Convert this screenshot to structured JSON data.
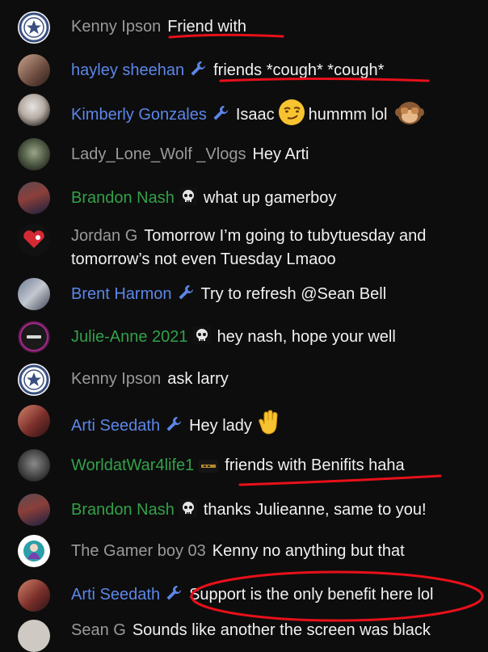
{
  "colors": {
    "background": "#0d0d0d",
    "moderator_name": "#5c86e8",
    "member_name": "#33a04a",
    "viewer_name": "#9a9a9a",
    "annotation": "#e8101a"
  },
  "messages": [
    {
      "author": "Kenny Ipson",
      "role": "viewer",
      "badge": "",
      "avatar": "dallas-star-logo",
      "text": "Friend with"
    },
    {
      "author": "hayley sheehan",
      "role": "moderator",
      "badge": "wrench-icon",
      "avatar": "photo",
      "text": "friends *cough* *cough*"
    },
    {
      "author": "Kimberly Gonzales",
      "role": "moderator",
      "badge": "wrench-icon",
      "avatar": "photo",
      "text_before": "Isaac",
      "emoji1": "smirking-face-emoji",
      "text_after": "hummm lol",
      "emoji2": "see-no-evil-monkey-emoji"
    },
    {
      "author": "Lady_Lone_Wolf _Vlogs",
      "role": "viewer",
      "badge": "",
      "avatar": "photo",
      "text": "Hey Arti"
    },
    {
      "author": "Brandon Nash",
      "role": "member",
      "badge": "skull-icon",
      "avatar": "photo",
      "text": "what up gamerboy"
    },
    {
      "author": "Jordan G",
      "role": "viewer",
      "badge": "",
      "avatar": "photo",
      "text": "Tomorrow I’m going to tubytuesday and tomorrow’s not even Tuesday Lmaoo"
    },
    {
      "author": "Brent Harmon",
      "role": "moderator",
      "badge": "wrench-icon",
      "avatar": "photo",
      "text": "Try to refresh @Sean Bell"
    },
    {
      "author": "Julie-Anne 2021",
      "role": "member",
      "badge": "skull-icon",
      "avatar": "logo",
      "text": "hey nash, hope your well"
    },
    {
      "author": "Kenny Ipson",
      "role": "viewer",
      "badge": "",
      "avatar": "dallas-star-logo",
      "text": "ask larry"
    },
    {
      "author": "Arti Seedath",
      "role": "moderator",
      "badge": "wrench-icon",
      "avatar": "photo",
      "text": "Hey lady",
      "emoji1": "waving-hand-emoji"
    },
    {
      "author": "WorldatWar4life1",
      "role": "member",
      "badge": "member-badge-icon",
      "avatar": "photo",
      "text": "friends with Benifits haha"
    },
    {
      "author": "Brandon Nash",
      "role": "member",
      "badge": "skull-icon",
      "avatar": "photo",
      "text": "thanks Julieanne, same to you!"
    },
    {
      "author": "The Gamer boy 03",
      "role": "viewer",
      "badge": "",
      "avatar": "photo",
      "text": "Kenny no anything but that"
    },
    {
      "author": "Arti Seedath",
      "role": "moderator",
      "badge": "wrench-icon",
      "avatar": "photo",
      "text": "Support is the only benefit here lol"
    },
    {
      "author": "Sean G",
      "role": "viewer",
      "badge": "",
      "avatar": "photo",
      "text": "Sounds like another the screen was black"
    }
  ]
}
